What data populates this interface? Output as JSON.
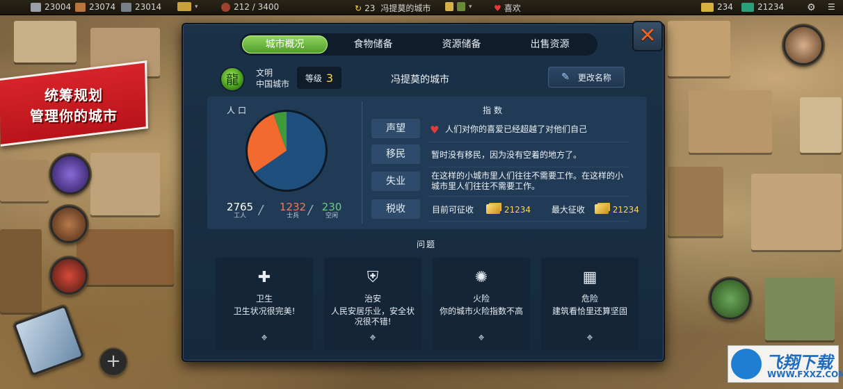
{
  "topbar": {
    "resources": [
      {
        "icon": "stone-icon",
        "value": "23004"
      },
      {
        "icon": "wood-icon",
        "value": "23074"
      },
      {
        "icon": "iron-icon",
        "value": "23014"
      }
    ],
    "population": "212 / 3400",
    "turn": "23",
    "city_title": "冯提莫的城市",
    "mood": "喜欢",
    "gold": "234",
    "gems": "21234"
  },
  "promo": {
    "line1": "统筹规划",
    "line2": "管理你的城市"
  },
  "tabs": [
    {
      "label": "城市概况",
      "active": true
    },
    {
      "label": "食物储备",
      "active": false
    },
    {
      "label": "资源储备",
      "active": false
    },
    {
      "label": "出售资源",
      "active": false
    }
  ],
  "header": {
    "civ_line1": "文明",
    "civ_line2": "中国城市",
    "level_label": "等级",
    "level_value": "3",
    "city_name": "冯提莫的城市",
    "rename_label": "更改名称"
  },
  "population": {
    "title": "人口",
    "workers_value": "2765",
    "workers_label": "工人",
    "soldiers_value": "1232",
    "soldiers_label": "士兵",
    "idle_value": "230",
    "idle_label": "空闲",
    "colors": {
      "workers": "#1f4f7c",
      "soldiers": "#f26a2e",
      "idle": "#3f9a3c"
    }
  },
  "indices": {
    "title": "指数",
    "rows": [
      {
        "label": "声望",
        "text": "人们对你的喜爱已经超越了对他们自己"
      },
      {
        "label": "移民",
        "text": "暂时没有移民，因为没有空着的地方了。"
      },
      {
        "label": "失业",
        "text": "在这样的小城市里人们往往不需要工作。在这样的小城市里人们往往不需要工作。"
      },
      {
        "label": "税收",
        "current_label": "目前可征收",
        "current_value": "21234",
        "max_label": "最大征收",
        "max_value": "21234"
      }
    ]
  },
  "issues": {
    "title": "问题",
    "items": [
      {
        "icon": "health-cross-icon",
        "name": "卫生",
        "desc": "卫生状况很完美!"
      },
      {
        "icon": "security-shield-icon",
        "name": "治安",
        "desc": "人民安居乐业，安全状况很不错!"
      },
      {
        "icon": "fire-icon",
        "name": "火险",
        "desc": "你的城市火险指数不高"
      },
      {
        "icon": "building-risk-icon",
        "name": "危险",
        "desc": "建筑看恰里还算坚固"
      }
    ]
  },
  "watermark": {
    "title": "飞翔下载",
    "url": "WWW.FXXZ.COM"
  }
}
